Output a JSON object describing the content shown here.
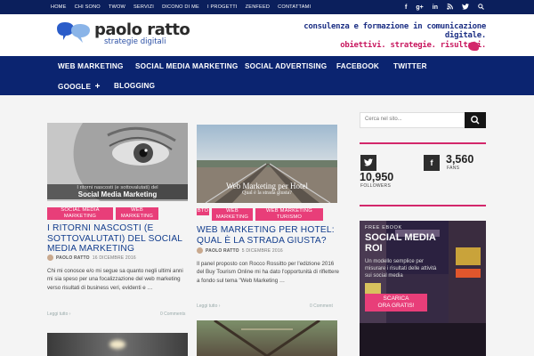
{
  "topbar": {
    "links": [
      "HOME",
      "CHI SONO",
      "TWOW",
      "SERVIZI",
      "DICONO DI ME",
      "I PROGETTI",
      "ZENFEED",
      "CONTATTAMI"
    ],
    "social_icons": [
      "facebook-icon",
      "google-plus-icon",
      "linkedin-icon",
      "rss-icon",
      "twitter-icon",
      "search-icon"
    ]
  },
  "header": {
    "logo_name": "paolo ratto",
    "logo_tagline": "strategie digitali",
    "slogan_line1": "consulenza e formazione in comunicazione digitale.",
    "slogan_line2": "obiettivi. strategie. risultati."
  },
  "nav": {
    "items": [
      "WEB MARKETING",
      "SOCIAL MEDIA MARKETING",
      "SOCIAL ADVERTISING",
      "FACEBOOK",
      "TWITTER",
      "GOOGLE",
      "BLOGGING"
    ],
    "google_plus": "+"
  },
  "posts": [
    {
      "thumb_caption1": "I ritorni nascosti (e sottovalutati) del",
      "thumb_caption2": "Social Media Marketing",
      "categories": [
        "SOCIAL MEDIA MARKETING",
        "WEB MARKETING"
      ],
      "title": "I RITORNI NASCOSTI (E SOTTOVALUTATI) DEL SOCIAL MEDIA MARKETING",
      "author": "PAOLO RATTO",
      "date": "16 DICEMBRE 2016",
      "excerpt": "Chi mi conosce e/o mi segue sa quanto negli ultimi anni mi sia speso per una focalizzazione del web marketing verso risultati di business veri, evidenti e …",
      "read_more": "Leggi tutto",
      "comments": "0 Comments"
    },
    {
      "thumb_caption1": "Web Marketing per Hotel",
      "thumb_caption2": "Qual è la strada giusta?",
      "categories": [
        "WEB MARKETING",
        "WEB MARKETING TURISMO"
      ],
      "cat_prefix": "BTO",
      "title": "WEB MARKETING PER HOTEL: QUAL È LA STRADA GIUSTA?",
      "author": "PAOLO RATTO",
      "date": "5 DICEMBRE 2016",
      "excerpt": "Il panel proposto con Rocco Rossitto per l'edizione 2016 del Buy Tourism Online mi ha dato l'opportunità di riflettere a fondo sul tema \"Web Marketing …",
      "read_more": "Leggi tutto",
      "comments": "0 Comment"
    }
  ],
  "sidebar": {
    "search_placeholder": "Cerca nel sito...",
    "fans_count": "3,560",
    "fans_label": "FANS",
    "followers_count": "10,950",
    "followers_label": "FOLLOWERS",
    "ebook_label": "FREE EBOOK",
    "ebook_title1": "SOCIAL MEDIA",
    "ebook_title2": "ROI",
    "ebook_text": "Un modello semplice per misurare i risultati delle attività sui social media",
    "ebook_button1": "SCARICA",
    "ebook_button2": "ORA GRATIS!"
  },
  "colors": {
    "nav_bg": "#0b2470",
    "accent": "#e83e79",
    "title": "#123d8d"
  }
}
